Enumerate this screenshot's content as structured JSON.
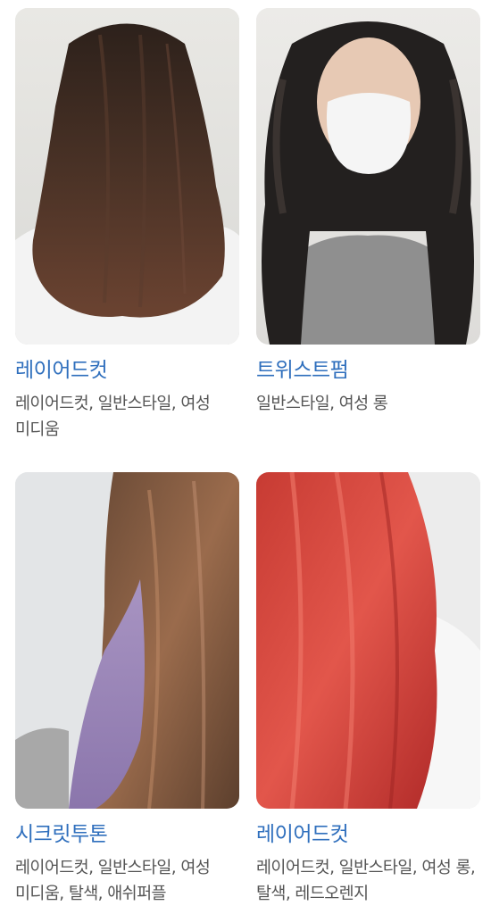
{
  "cards": [
    {
      "title": "레이어드컷",
      "tags": "레이어드컷, 일반스타일, 여성 미디움",
      "image_label": "brown-layered-cut-photo"
    },
    {
      "title": "트위스트펌",
      "tags": "일반스타일, 여성 롱",
      "image_label": "dark-twist-perm-photo"
    },
    {
      "title": "시크릿투톤",
      "tags": "레이어드컷, 일반스타일, 여성 미디움, 탈색, 애쉬퍼플",
      "image_label": "brown-purple-secret-two-tone-photo"
    },
    {
      "title": "레이어드컷",
      "tags": "레이어드컷, 일반스타일, 여성 롱, 탈색, 레드오렌지",
      "image_label": "red-layered-cut-photo"
    }
  ],
  "colors": {
    "title": "#2f6fbd",
    "tags": "#555555"
  }
}
